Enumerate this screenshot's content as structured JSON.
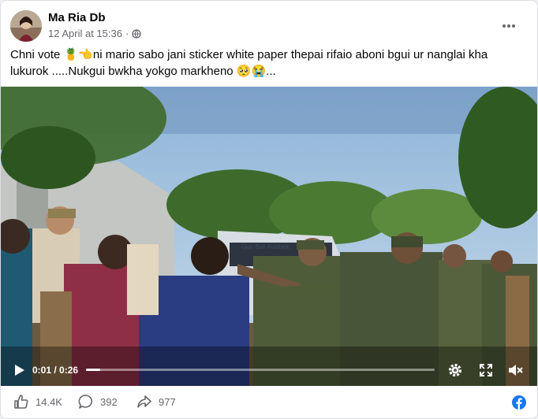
{
  "post": {
    "author": "Ma Ria Db",
    "date": "12 April at 15:36",
    "separator": "·",
    "audience_icon": "globe-icon",
    "more_icon": "more-horizontal-icon",
    "text_line1": "Chni vote 🍍👈ni mario sabo jani sticker white paper thepai rifaio aboni bgui ur nanglai kha",
    "text_line2": "lukurok .....Nukgui bwkha yokgo markheno 🥺😭..."
  },
  "video": {
    "current_time": "0:01",
    "duration_sep": " / ",
    "duration": "0:26",
    "progress": 0.04,
    "bus_text": "Gun Boli Avishek",
    "icons": [
      "play-icon",
      "settings-icon",
      "fullscreen-icon",
      "mute-icon"
    ]
  },
  "actions": {
    "likes": "14.4K",
    "comments": "392",
    "shares": "977",
    "icons": [
      "like-icon",
      "comment-icon",
      "share-icon",
      "facebook-badge-icon"
    ]
  },
  "colors": {
    "brand": "#1877f2",
    "text_primary": "#050505",
    "text_secondary": "#65676b"
  }
}
